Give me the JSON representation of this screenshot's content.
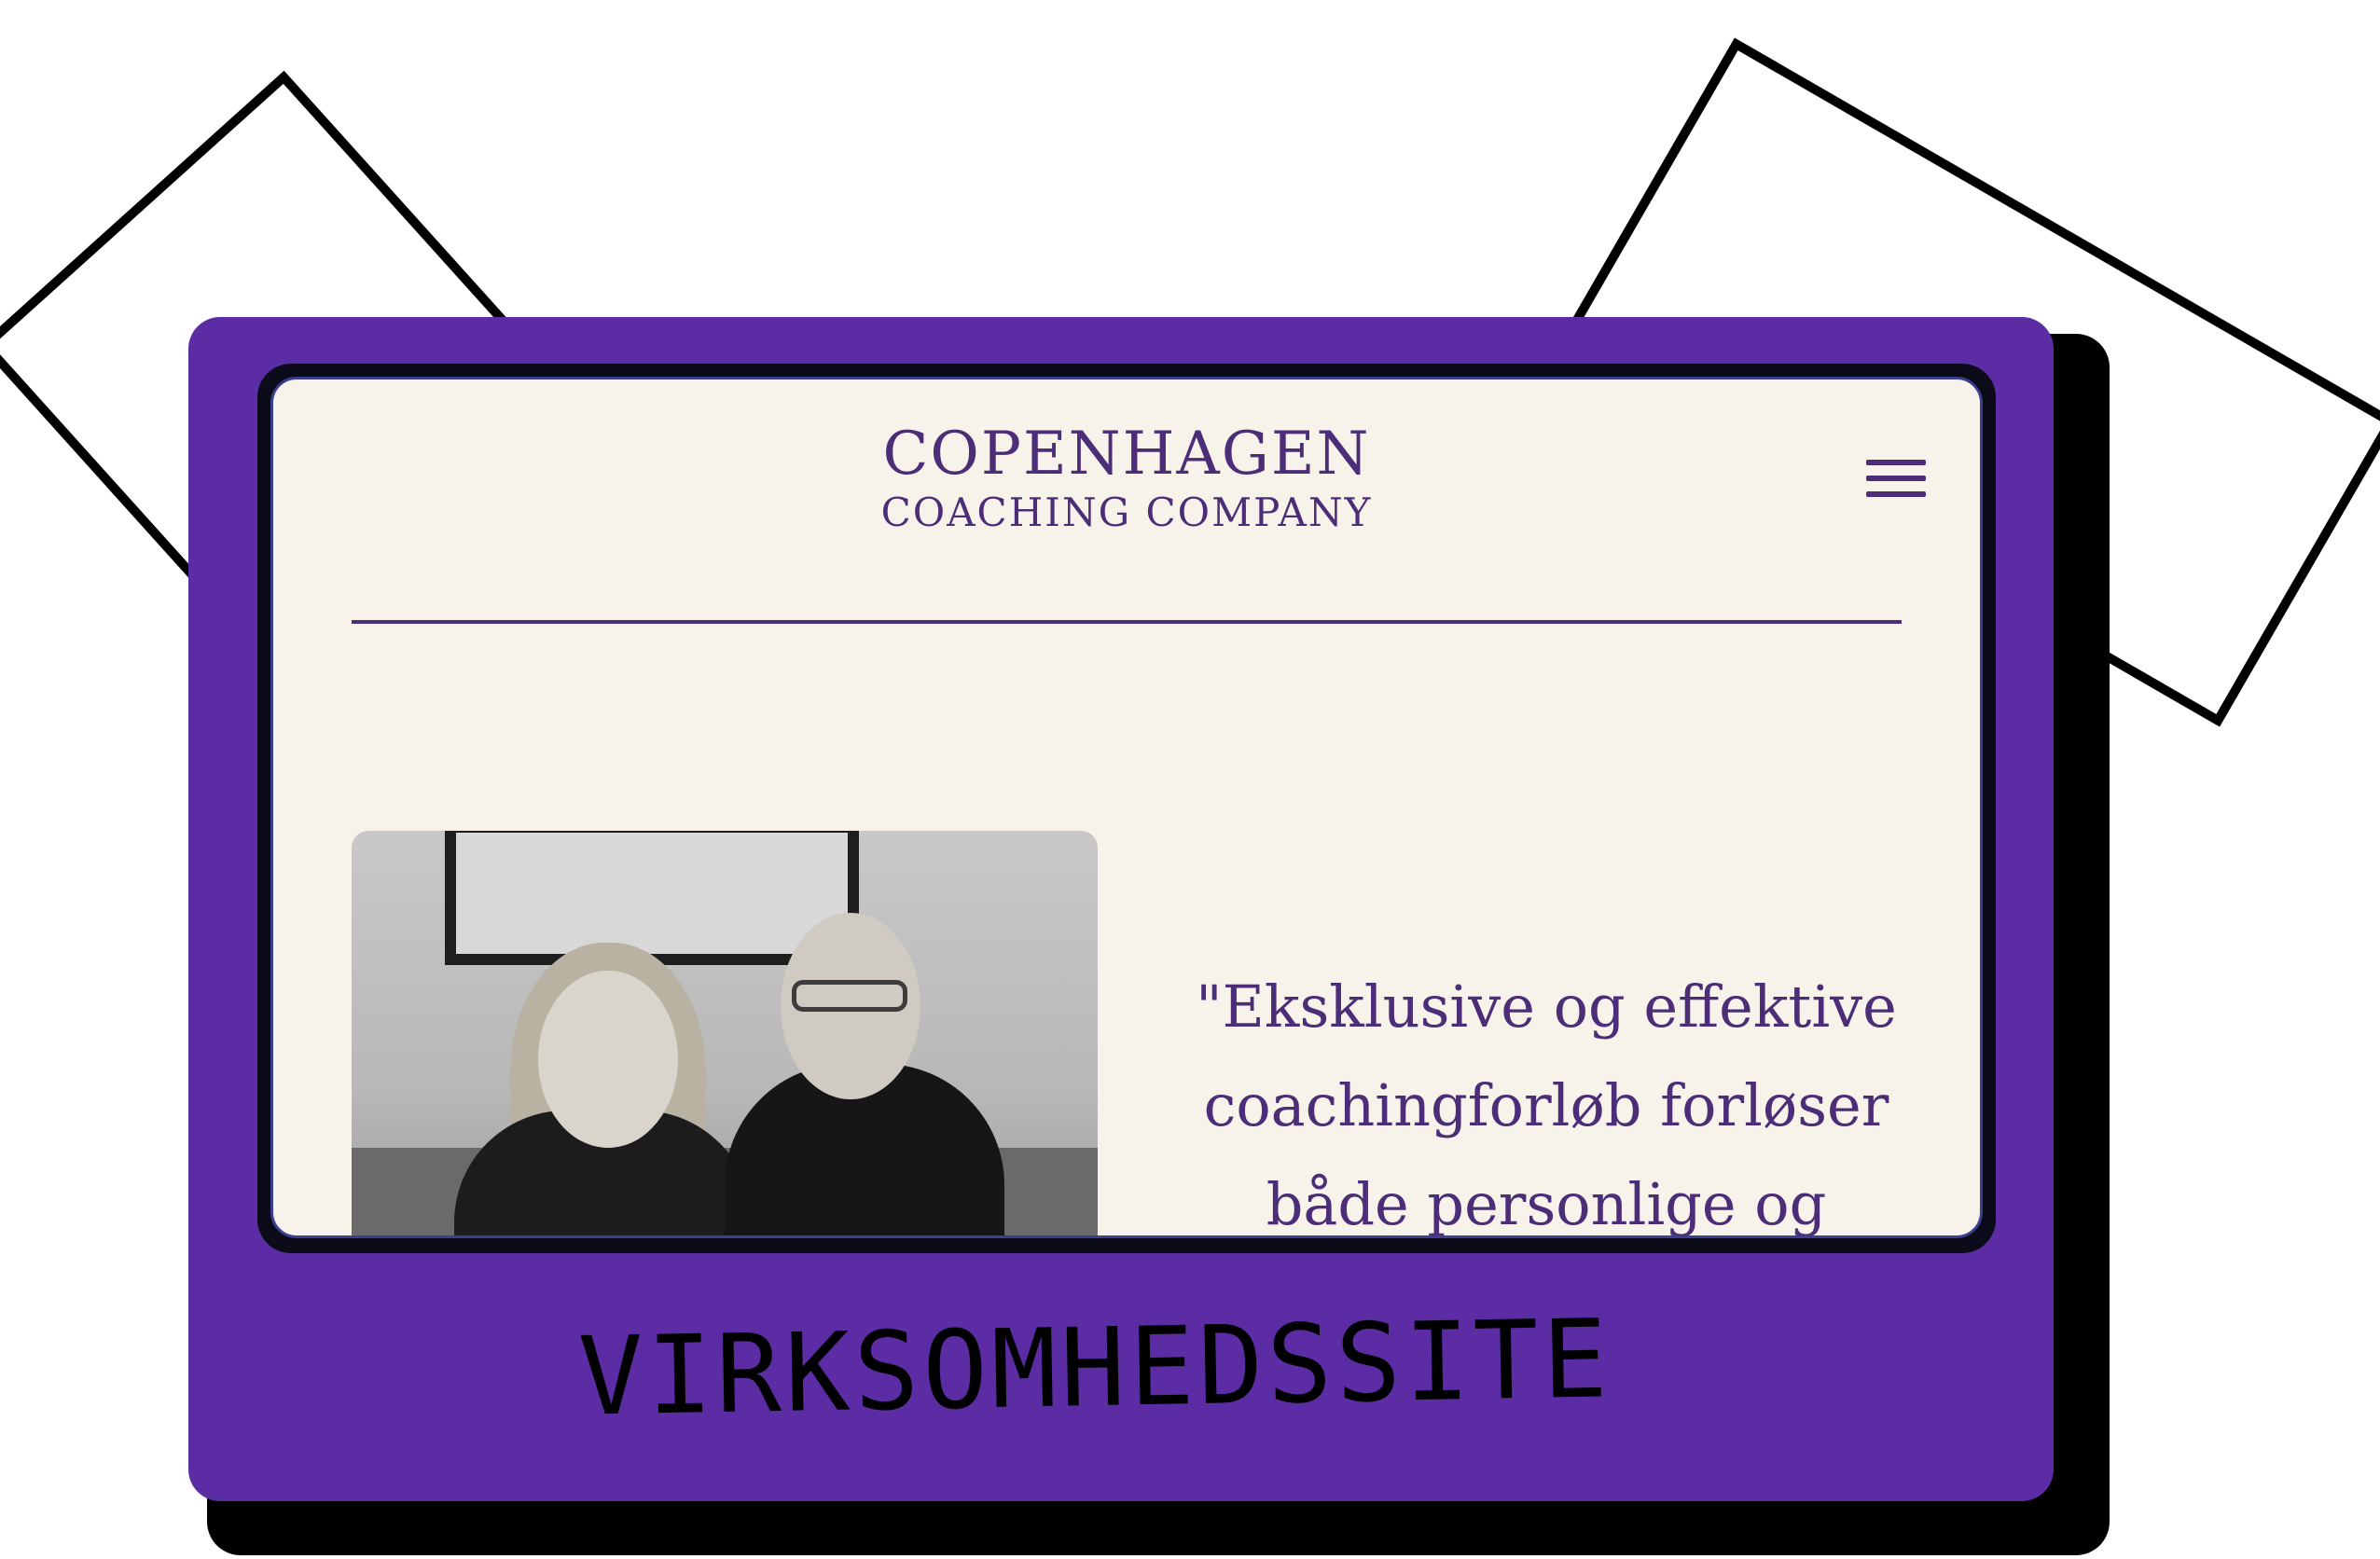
{
  "logo": {
    "line1": "COPENHAGEN",
    "line2": "COACHING COMPANY"
  },
  "hero": {
    "quote": "\"Eksklusive og effektive coachingforløb forløser både personlige og"
  },
  "card": {
    "label": "VIRKSOMHEDSSITE"
  },
  "colors": {
    "card_purple": "#5b2ca3",
    "brand_purple": "#4b2d78",
    "page_cream": "#f7f3ea"
  },
  "icons": {
    "menu": "hamburger-menu-icon"
  }
}
